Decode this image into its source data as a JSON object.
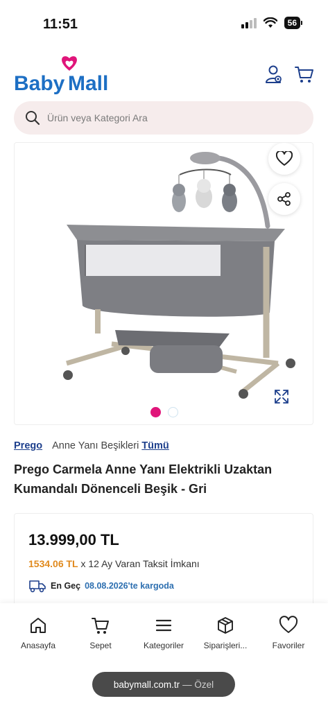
{
  "status_bar": {
    "time": "11:51",
    "battery": "56"
  },
  "header": {
    "logo_text": "BabyMall"
  },
  "search": {
    "placeholder": "Ürün veya Kategori Ara"
  },
  "gallery": {
    "image_count": 2,
    "active_index": 0
  },
  "breadcrumb": {
    "brand": "Prego",
    "category": "Anne Yanı Beşikleri",
    "all": "Tümü"
  },
  "product": {
    "title": "Prego Carmela Anne Yanı Elektrikli Uzaktan Kumandalı Dönenceli Beşik - Gri",
    "price": "13.999,00 TL",
    "installment_amount": "1534.06 TL",
    "installment_text": "x 12 Ay Varan Taksit İmkanı",
    "delivery_label": "En Geç",
    "delivery_date": "08.08.2026'te kargoda"
  },
  "tabbar": {
    "items": [
      {
        "label": "Anasayfa",
        "icon": "home-icon"
      },
      {
        "label": "Sepet",
        "icon": "cart-icon"
      },
      {
        "label": "Kategoriler",
        "icon": "menu-icon"
      },
      {
        "label": "Siparişleri...",
        "icon": "box-icon"
      },
      {
        "label": "Favoriler",
        "icon": "heart-icon"
      }
    ]
  },
  "browser": {
    "url": "babymall.com.tr",
    "mode": "— Özel"
  },
  "colors": {
    "brand_blue": "#1d3f8c",
    "brand_pink": "#e0157a",
    "installment_orange": "#e08a1e",
    "link_blue": "#2d6fb0"
  }
}
